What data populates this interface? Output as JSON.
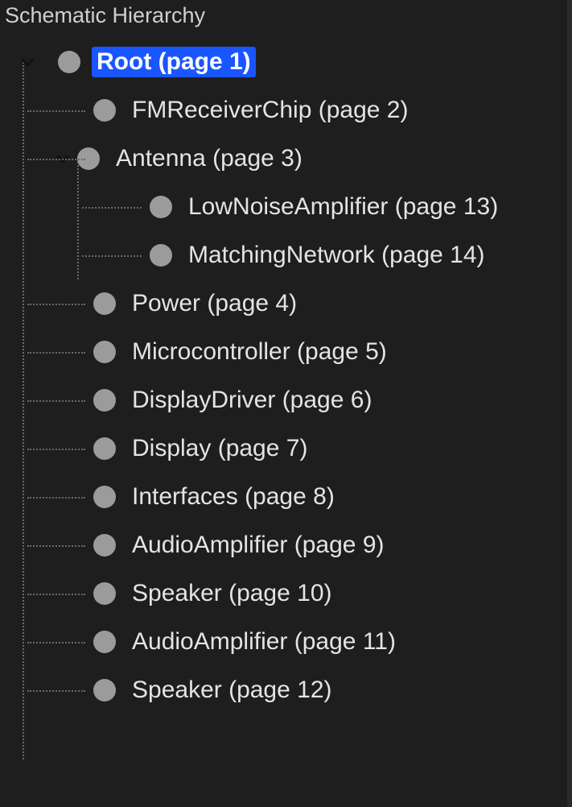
{
  "panel": {
    "title": "Schematic Hierarchy"
  },
  "colors": {
    "selection": "#1a56ff",
    "bullet": "#9b9b9b",
    "guide": "#6a6a6a",
    "bg": "#1e1e1e"
  },
  "tree": {
    "root": {
      "label": "Root (page 1)",
      "expanded": true,
      "selected": true,
      "children": [
        {
          "label": "FMReceiverChip (page 2)"
        },
        {
          "label": "Antenna (page 3)",
          "expanded": true,
          "children": [
            {
              "label": "LowNoiseAmplifier (page 13)"
            },
            {
              "label": "MatchingNetwork (page 14)"
            }
          ]
        },
        {
          "label": "Power (page 4)"
        },
        {
          "label": "Microcontroller (page 5)"
        },
        {
          "label": "DisplayDriver (page 6)"
        },
        {
          "label": "Display (page 7)"
        },
        {
          "label": "Interfaces (page 8)"
        },
        {
          "label": "AudioAmplifier (page 9)"
        },
        {
          "label": "Speaker (page 10)"
        },
        {
          "label": "AudioAmplifier (page 11)"
        },
        {
          "label": "Speaker (page 12)"
        }
      ]
    }
  }
}
